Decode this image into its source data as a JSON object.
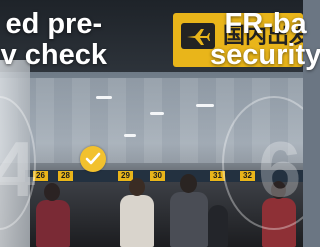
{
  "scene": {
    "type": "airport-terminal-photo"
  },
  "overlay": {
    "left_caption_line1": "ed pre-",
    "left_caption_line2": "v check",
    "right_caption_line1": "FR-ba",
    "right_caption_line2": "security"
  },
  "signage": {
    "chinese_label": "国内出发",
    "gate_numbers": [
      "26",
      "28",
      "29",
      "30",
      "31",
      "32"
    ]
  },
  "badge": {
    "icon": "check-icon",
    "color": "#f2c12e"
  },
  "colors": {
    "sign_yellow": "#e9b51a",
    "caption_text": "#ffffff"
  }
}
